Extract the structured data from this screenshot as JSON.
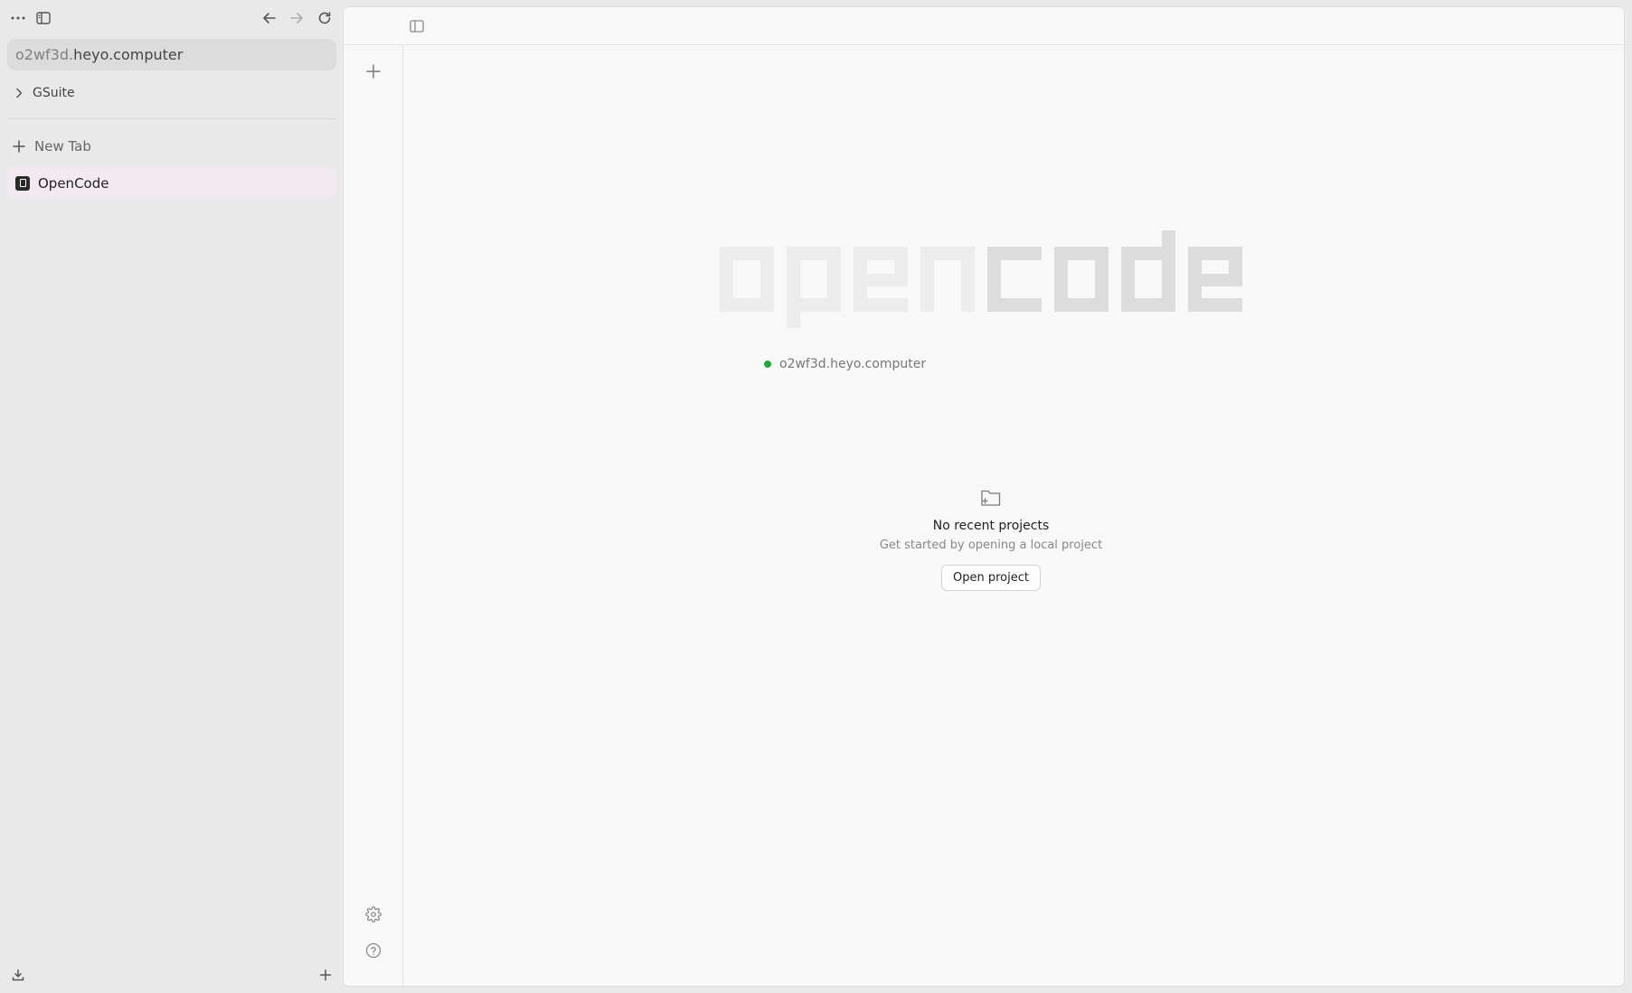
{
  "browser": {
    "url": {
      "subdomain": "o2wf3d.",
      "host": "heyo.computer"
    },
    "folder": {
      "label": "GSuite"
    },
    "new_tab_label": "New Tab",
    "tabs": [
      {
        "label": "OpenCode",
        "active": true
      }
    ]
  },
  "app": {
    "logo_text": {
      "light": "open",
      "dark": "code"
    },
    "server": {
      "host": "o2wf3d.heyo.computer",
      "status_color": "#1fad3a"
    },
    "empty_state": {
      "title": "No recent projects",
      "subtitle": "Get started by opening a local project",
      "button_label": "Open project"
    }
  },
  "icons": {
    "menu": "more-horizontal-icon",
    "sidebar": "sidebar-toggle-icon",
    "back": "arrow-left-icon",
    "forward": "arrow-right-icon",
    "reload": "reload-icon",
    "download": "download-icon",
    "add": "plus-icon",
    "settings": "gear-icon",
    "help": "help-circle-icon",
    "folder_add": "folder-plus-icon"
  }
}
